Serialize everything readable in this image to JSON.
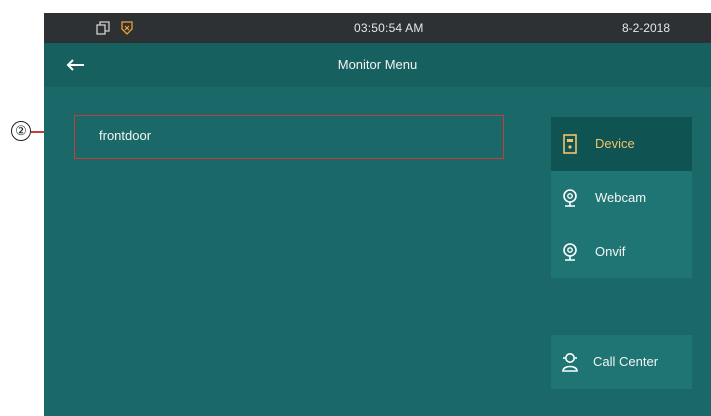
{
  "statusbar": {
    "time": "03:50:54   AM",
    "date": "8-2-2018",
    "icons": [
      "copy-icon",
      "shield-icon"
    ]
  },
  "titlebar": {
    "title": "Monitor Menu",
    "back_icon": "back-arrow-icon"
  },
  "list": {
    "items": [
      {
        "label": "frontdoor"
      }
    ]
  },
  "sidebar": {
    "items": [
      {
        "label": "Device",
        "icon": "device-icon",
        "active": true
      },
      {
        "label": "Webcam",
        "icon": "webcam-icon",
        "active": false
      },
      {
        "label": "Onvif",
        "icon": "onvif-camera-icon",
        "active": false
      }
    ],
    "call_center": {
      "label": "Call Center",
      "icon": "call-center-icon"
    }
  },
  "annotation": {
    "callout_number": "②"
  },
  "colors": {
    "screen_bg": "#1a6968",
    "statusbar_bg": "#2d3134",
    "titlebar_bg": "#16605f",
    "sidebar_bg": "#1f7574",
    "sidebar_active_bg": "#0f5352",
    "active_text": "#f0c26b",
    "highlight_border": "#c63c3c"
  }
}
